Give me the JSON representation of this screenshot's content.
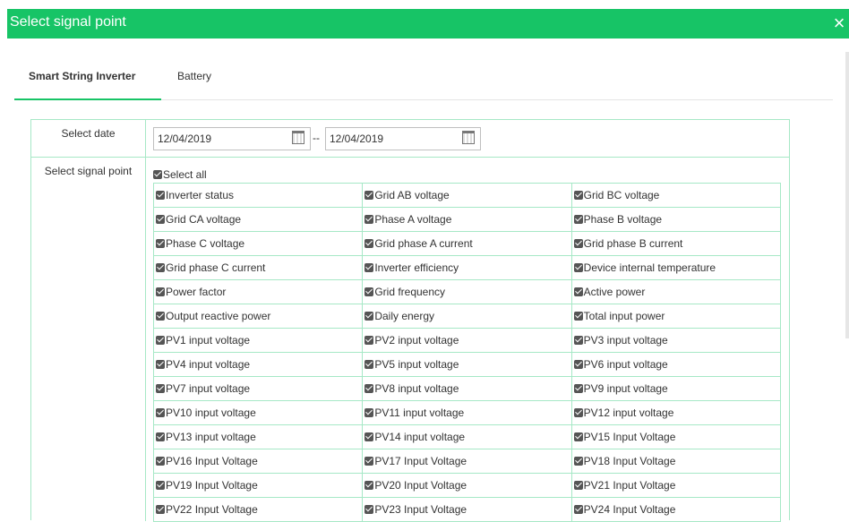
{
  "dialog": {
    "title": "Select signal point",
    "close_label": "×"
  },
  "tabs": [
    {
      "label": "Smart String Inverter",
      "active": true
    },
    {
      "label": "Battery",
      "active": false
    }
  ],
  "date": {
    "label": "Select date",
    "start": "12/04/2019",
    "separator": "--",
    "end": "12/04/2019"
  },
  "signal": {
    "label": "Select signal point",
    "select_all": "Select all",
    "points": [
      "Inverter status",
      "Grid AB voltage",
      "Grid BC voltage",
      "Grid CA voltage",
      "Phase A voltage",
      "Phase B voltage",
      "Phase C voltage",
      "Grid phase A current",
      "Grid phase B current",
      "Grid phase C current",
      "Inverter efficiency",
      "Device internal temperature",
      "Power factor",
      "Grid frequency",
      "Active power",
      "Output reactive power",
      "Daily energy",
      "Total input power",
      "PV1 input voltage",
      "PV2 input voltage",
      "PV3 input voltage",
      "PV4 input voltage",
      "PV5 input voltage",
      "PV6 input voltage",
      "PV7 input voltage",
      "PV8 input voltage",
      "PV9 input voltage",
      "PV10 input voltage",
      "PV11 input voltage",
      "PV12 input voltage",
      "PV13 input voltage",
      "PV14 input voltage",
      "PV15 Input Voltage",
      "PV16 Input Voltage",
      "PV17 Input Voltage",
      "PV18 Input Voltage",
      "PV19 Input Voltage",
      "PV20 Input Voltage",
      "PV21 Input Voltage",
      "PV22 Input Voltage",
      "PV23 Input Voltage",
      "PV24 Input Voltage"
    ]
  },
  "colors": {
    "accent": "#17c466",
    "border": "#a6e8c6"
  }
}
